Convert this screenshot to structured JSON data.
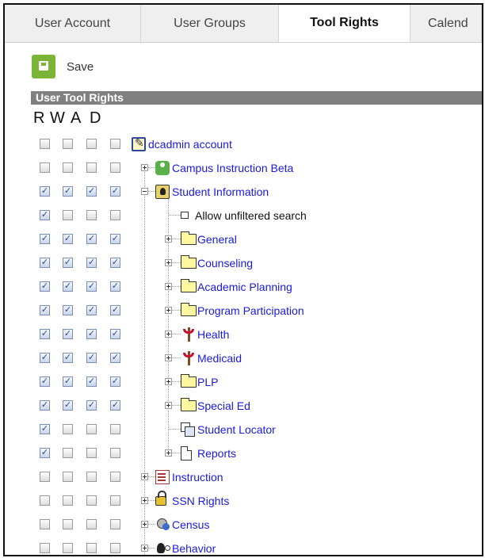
{
  "tabs": [
    {
      "label": "User Account"
    },
    {
      "label": "User Groups"
    },
    {
      "label": "Tool Rights"
    },
    {
      "label": "Calend"
    }
  ],
  "toolbar": {
    "save_label": "Save"
  },
  "section_title": "User Tool Rights",
  "columns": [
    "R",
    "W",
    "A",
    "D"
  ],
  "rows": [
    {
      "label": "dcadmin account",
      "icon": "account-icon",
      "expander": "none",
      "checks": [
        false,
        false,
        false,
        false
      ]
    },
    {
      "label": "Campus Instruction Beta",
      "icon": "person-green-icon",
      "expander": "plus",
      "checks": [
        false,
        false,
        false,
        false
      ]
    },
    {
      "label": "Student Information",
      "icon": "student-icon",
      "expander": "minus",
      "checks": [
        true,
        true,
        true,
        true
      ]
    },
    {
      "label": "Allow unfiltered search",
      "icon": "document-icon",
      "expander": "none",
      "checks": [
        true,
        false,
        false,
        false
      ]
    },
    {
      "label": "General",
      "icon": "folder-icon",
      "expander": "plus",
      "checks": [
        true,
        true,
        true,
        true
      ]
    },
    {
      "label": "Counseling",
      "icon": "folder-icon",
      "expander": "plus",
      "checks": [
        true,
        true,
        true,
        true
      ]
    },
    {
      "label": "Academic Planning",
      "icon": "folder-icon",
      "expander": "plus",
      "checks": [
        true,
        true,
        true,
        true
      ]
    },
    {
      "label": "Program Participation",
      "icon": "folder-icon",
      "expander": "plus",
      "checks": [
        true,
        true,
        true,
        true
      ]
    },
    {
      "label": "Health",
      "icon": "health-icon",
      "expander": "plus",
      "checks": [
        true,
        true,
        true,
        true
      ]
    },
    {
      "label": "Medicaid",
      "icon": "health-icon",
      "expander": "plus",
      "checks": [
        true,
        true,
        true,
        true
      ]
    },
    {
      "label": "PLP",
      "icon": "folder-icon",
      "expander": "plus",
      "checks": [
        true,
        true,
        true,
        true
      ]
    },
    {
      "label": "Special Ed",
      "icon": "folder-icon",
      "expander": "plus",
      "checks": [
        true,
        true,
        true,
        true
      ]
    },
    {
      "label": "Student Locator",
      "icon": "locator-icon",
      "expander": "none",
      "checks": [
        true,
        false,
        false,
        false
      ]
    },
    {
      "label": "Reports",
      "icon": "document-icon",
      "expander": "plus",
      "checks": [
        true,
        false,
        false,
        false
      ]
    },
    {
      "label": "Instruction",
      "icon": "instruction-icon",
      "expander": "plus",
      "checks": [
        false,
        false,
        false,
        false
      ]
    },
    {
      "label": "SSN Rights",
      "icon": "lock-icon",
      "expander": "plus",
      "checks": [
        false,
        false,
        false,
        false
      ]
    },
    {
      "label": "Census",
      "icon": "census-icon",
      "expander": "plus",
      "checks": [
        false,
        false,
        false,
        false
      ]
    },
    {
      "label": "Behavior",
      "icon": "behavior-icon",
      "expander": "plus",
      "checks": [
        false,
        false,
        false,
        false
      ]
    }
  ]
}
